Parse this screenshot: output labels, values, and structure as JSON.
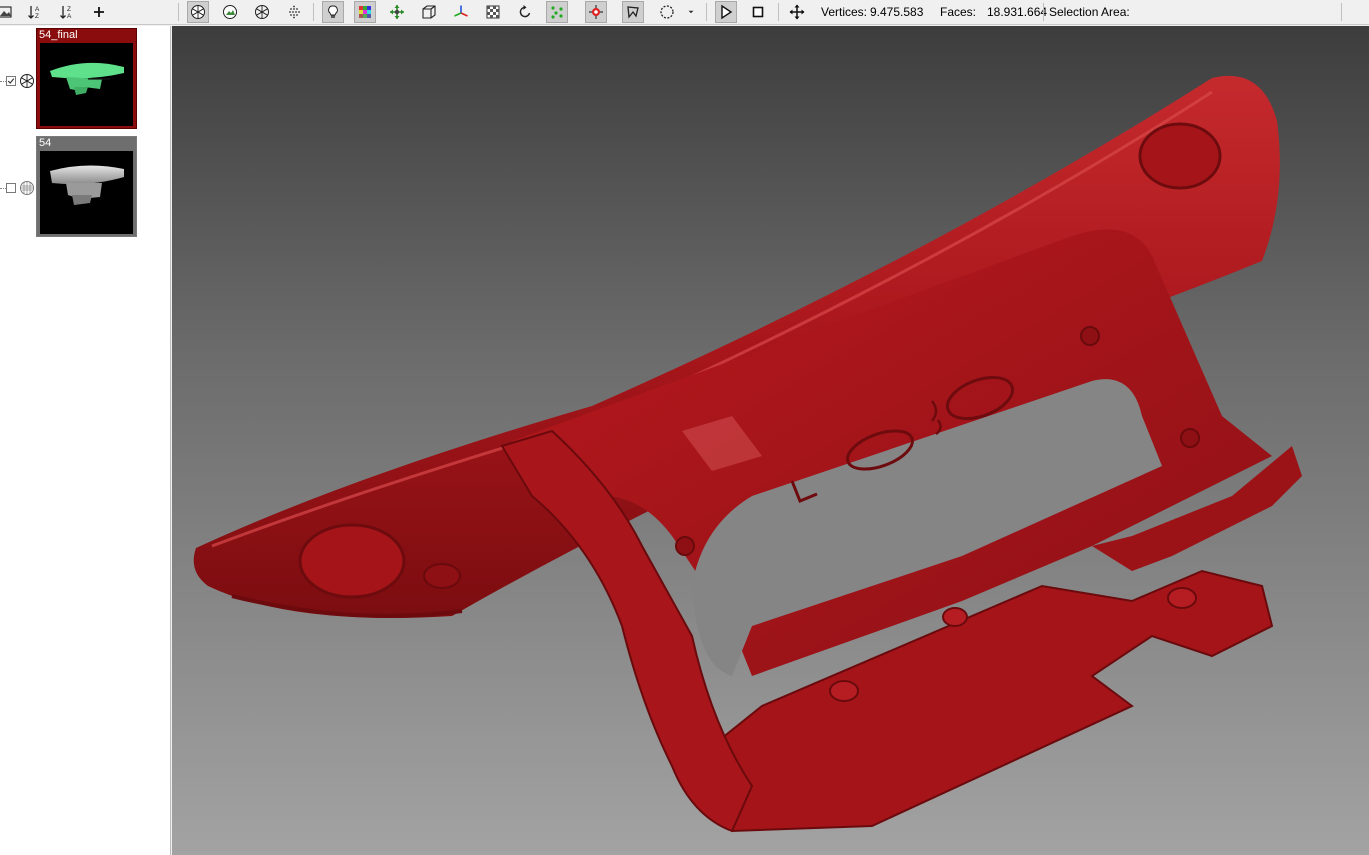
{
  "toolbar": {
    "vertices_label": "Vertices:",
    "vertices_value": "9.475.583",
    "faces_label": "Faces:",
    "faces_value": "18.931.664",
    "selection_label": "Selection Area:"
  },
  "layers": [
    {
      "name": "54_final",
      "visible": true,
      "selected": true
    },
    {
      "name": "54",
      "visible": false,
      "selected": false
    }
  ],
  "colors": {
    "mesh": "#a8161b",
    "selected_layer": "#8b0c0c",
    "thumb_final": "#5fe08a",
    "thumb_original": "#b8b8b8"
  }
}
